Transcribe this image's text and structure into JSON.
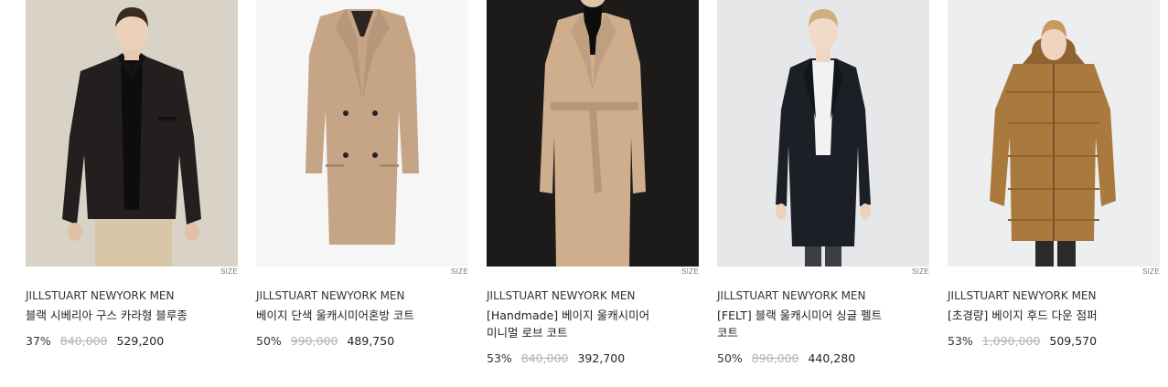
{
  "products": [
    {
      "brand": "JILLSTUART NEWYORK MEN",
      "name_lines": [
        "블랙 시베리아 구스 카라형 블루종"
      ],
      "size_label": "SIZE",
      "discount": "37%",
      "original_price": "840,000",
      "sale_price": "529,200",
      "image": {
        "desc-icon": "jacket-photo",
        "bg": "#d9d2c6",
        "garment": "#1e1c1b"
      }
    },
    {
      "brand": "JILLSTUART NEWYORK MEN",
      "name_lines": [
        "베이지 단색 울캐시미어혼방 코트"
      ],
      "size_label": "SIZE",
      "discount": "50%",
      "original_price": "990,000",
      "sale_price": "489,750",
      "image": {
        "desc-icon": "coat-photo",
        "bg": "#f6f6f6",
        "garment": "#c6a486"
      }
    },
    {
      "brand": "JILLSTUART NEWYORK MEN",
      "name_lines": [
        "[Handmade] 베이지 울캐시미어",
        "미니멀 로브 코트"
      ],
      "size_label": "SIZE",
      "discount": "53%",
      "original_price": "840,000",
      "sale_price": "392,700",
      "image": {
        "desc-icon": "robe-coat-photo",
        "bg": "#1d1b1a",
        "garment": "#cfae8e"
      }
    },
    {
      "brand": "JILLSTUART NEWYORK MEN",
      "name_lines": [
        "[FELT] 블랙 울캐시미어 싱글 펠트",
        "코트"
      ],
      "size_label": "SIZE",
      "discount": "50%",
      "original_price": "890,000",
      "sale_price": "440,280",
      "image": {
        "desc-icon": "black-coat-photo",
        "bg": "#e6e7e9",
        "garment": "#1c1f26"
      }
    },
    {
      "brand": "JILLSTUART NEWYORK MEN",
      "name_lines": [
        "[초경량] 베이지 후드 다운 점퍼"
      ],
      "size_label": "SIZE",
      "discount": "53%",
      "original_price": "1,090,000",
      "sale_price": "509,570",
      "image": {
        "desc-icon": "down-jacket-photo",
        "bg": "#eceef0",
        "garment": "#a9793e"
      }
    }
  ]
}
